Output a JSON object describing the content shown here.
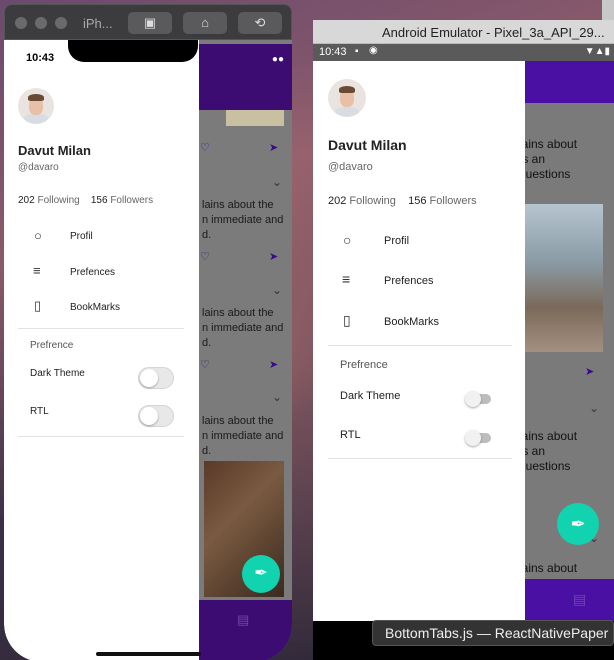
{
  "ios_window": {
    "title": "iPh...",
    "time": "10:43"
  },
  "android_window": {
    "title": "Android Emulator - Pixel_3a_API_29...",
    "time": "10:43"
  },
  "profile": {
    "name": "Davut Milan",
    "handle": "@davaro",
    "following_count": "202",
    "following_label": "Following",
    "followers_count": "156",
    "followers_label": "Followers"
  },
  "menu": {
    "items": [
      {
        "label": "Profil",
        "icon": "person-icon"
      },
      {
        "label": "Prefences",
        "icon": "sliders-icon"
      },
      {
        "label": "BookMarks",
        "icon": "bookmark-icon"
      }
    ]
  },
  "preferences": {
    "section_title": "Prefrence",
    "items": [
      {
        "label": "Dark Theme",
        "enabled": false
      },
      {
        "label": "RTL",
        "enabled": false
      }
    ]
  },
  "background_feed": {
    "ios_snippets": [
      "lains about the",
      "n immediate and",
      "d."
    ],
    "android_snippets": [
      "lains about",
      "ts an",
      " questions"
    ],
    "android_bottom_snippet": "lains about"
  },
  "tooltip": {
    "text": "BottomTabs.js — ReactNativePaper"
  },
  "colors": {
    "primary": "#4a0fa3",
    "fab": "#11d3b0"
  }
}
